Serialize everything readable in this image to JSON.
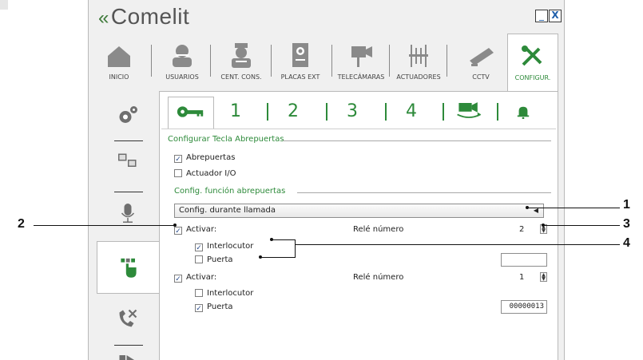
{
  "app": {
    "logo_text": "Comelit",
    "minimize_label": "_",
    "close_label": "X"
  },
  "nav": {
    "items": [
      {
        "label": "INICIO",
        "icon": "home-icon"
      },
      {
        "label": "USUARIOS",
        "icon": "user-icon"
      },
      {
        "label": "CENT. CONS.",
        "icon": "concierge-icon"
      },
      {
        "label": "PLACAS EXT",
        "icon": "entrance-panel-icon"
      },
      {
        "label": "TELECÁMARAS",
        "icon": "tele-camera-icon"
      },
      {
        "label": "ACTUADORES",
        "icon": "actuator-icon"
      },
      {
        "label": "CCTV",
        "icon": "cctv-camera-icon"
      },
      {
        "label": "CONFIGUR.",
        "icon": "tools-icon"
      }
    ],
    "active": "CONFIGUR."
  },
  "sidebar": {
    "items": [
      "gears-icon",
      "computers-icon",
      "microphone-icon",
      "hand-touch-icon",
      "phone-tools-icon",
      "forward-icon"
    ],
    "active": "hand-touch-icon"
  },
  "tabs": {
    "items": [
      "key-icon",
      "1",
      "2",
      "3",
      "4",
      "video-transfer-icon",
      "bell-icon"
    ],
    "active": "key-icon"
  },
  "form": {
    "group1_title": "Configurar Tecla Abrepuertas",
    "abrepuertas_label": "Abrepuertas",
    "abrepuertas_checked": true,
    "actuador_label": "Actuador I/O",
    "actuador_checked": false,
    "group2_title": "Config. función abrepuertas",
    "dropdown_value": "Config. durante llamada",
    "block1": {
      "activar_label": "Activar:",
      "activar_checked": true,
      "rele_label": "Relé número",
      "rele_value": "2",
      "interlocutor_label": "Interlocutor",
      "interlocutor_checked": true,
      "puerta_label": "Puerta",
      "puerta_checked": false,
      "puerta_code": ""
    },
    "block2": {
      "activar_label": "Activar:",
      "activar_checked": true,
      "rele_label": "Relé número",
      "rele_value": "1",
      "interlocutor_label": "Interlocutor",
      "interlocutor_checked": false,
      "puerta_label": "Puerta",
      "puerta_checked": true,
      "puerta_code": "00000013"
    }
  },
  "callouts": {
    "c1": "1",
    "c2": "2",
    "c3": "3",
    "c4": "4"
  },
  "colors": {
    "accent_green": "#2d8a3a",
    "frame_gray": "#f0f0f0"
  }
}
